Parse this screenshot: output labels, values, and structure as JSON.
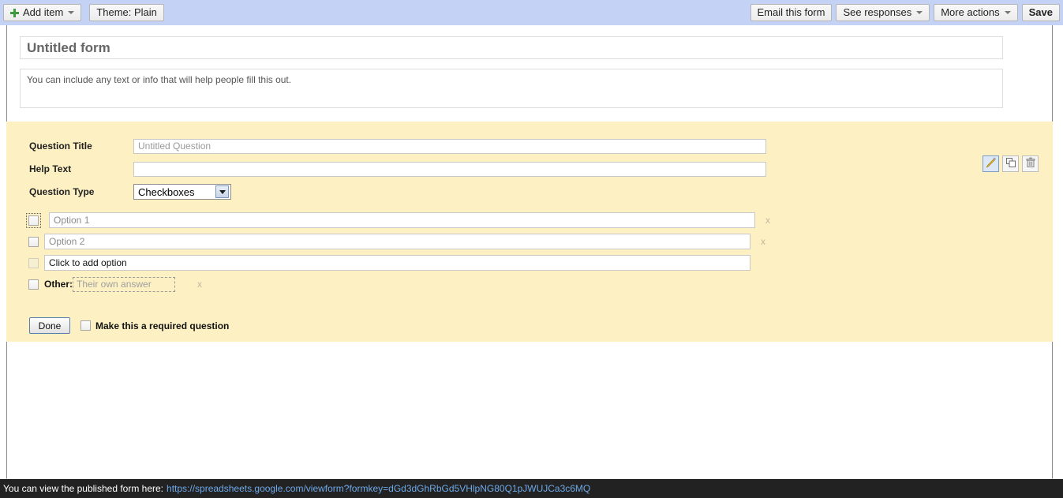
{
  "toolbar": {
    "add_item_label": "Add item",
    "theme_label": "Theme:  Plain",
    "email_form_label": "Email this form",
    "see_responses_label": "See responses",
    "more_actions_label": "More actions",
    "save_label": "Save"
  },
  "form": {
    "title": "Untitled form",
    "description": "You can include any text or info that will help people fill this out."
  },
  "question": {
    "title_label": "Question Title",
    "title_value": "Untitled Question",
    "help_label": "Help Text",
    "help_value": "",
    "type_label": "Question Type",
    "type_value": "Checkboxes",
    "options": [
      {
        "text": "Option 1",
        "remove_label": "x"
      },
      {
        "text": "Option 2",
        "remove_label": "x"
      },
      {
        "text": "Click to add option",
        "remove_label": ""
      }
    ],
    "other": {
      "label": "Other:",
      "placeholder": "Their own answer",
      "remove_label": "x"
    },
    "done_label": "Done",
    "required_label": "Make this a required question",
    "tools": {
      "edit": "pencil-icon",
      "duplicate": "duplicate-icon",
      "delete": "trash-icon"
    }
  },
  "statusbar": {
    "text": "You can view the published form here:",
    "url": "https://spreadsheets.google.com/viewform?formkey=dGd3dGhRbGd5VHlpNG80Q1pJWUJCa3c6MQ"
  },
  "colors": {
    "toolbar_bg": "#c3d2f5",
    "question_bg": "#fdf1c4",
    "statusbar_bg": "#222222",
    "link": "#6ea9e8",
    "plus_green": "#3c9a3c"
  }
}
